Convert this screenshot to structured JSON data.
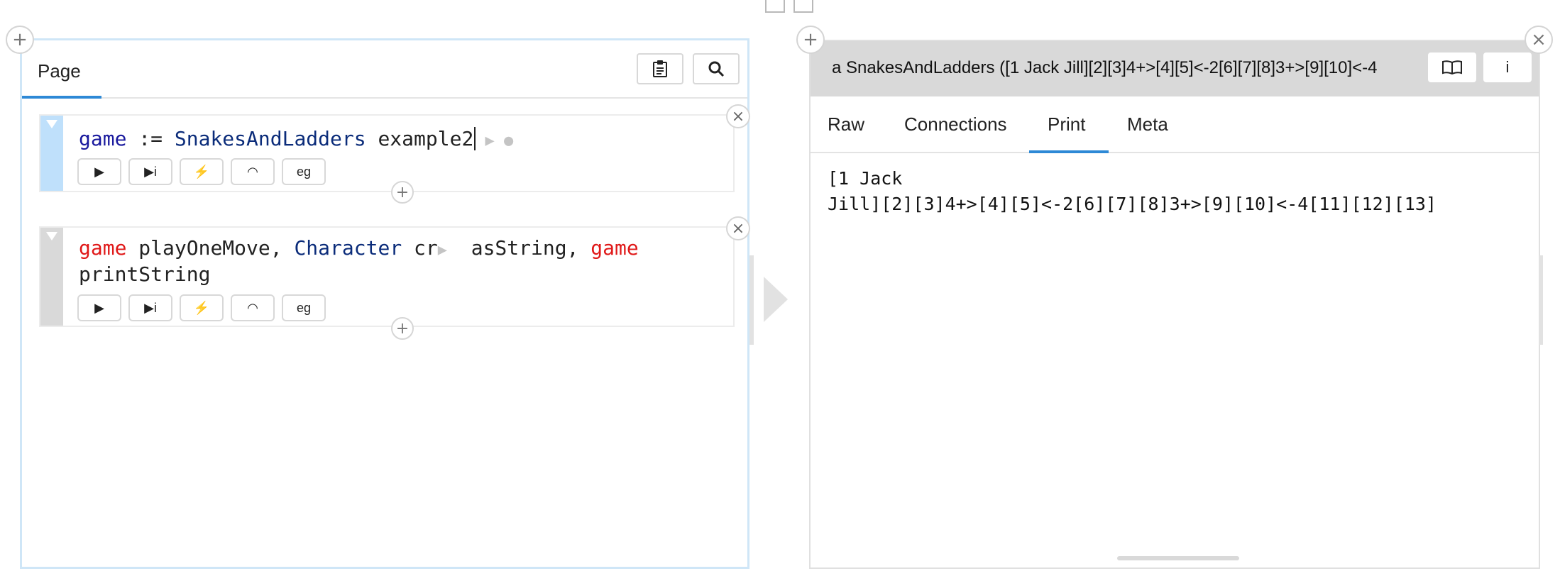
{
  "left_pane": {
    "tab_label": "Page",
    "clipboard_icon": "clipboard-icon",
    "search_icon": "search-icon",
    "snippets": [
      {
        "tokens": [
          {
            "t": "game",
            "c": "var"
          },
          {
            "t": " := ",
            "c": "plain"
          },
          {
            "t": "SnakesAndLadders",
            "c": "cls"
          },
          {
            "t": " example2",
            "c": "plain"
          }
        ],
        "buttons": [
          "play",
          "play-inspect",
          "debug",
          "profile",
          "eg"
        ],
        "eg_label": "eg"
      },
      {
        "line1": [
          {
            "t": "game",
            "c": "game"
          },
          {
            "t": " playOneMove, ",
            "c": "plain"
          },
          {
            "t": "Character",
            "c": "cls"
          },
          {
            "t": " cr",
            "c": "plain"
          },
          {
            "t": "  asString, ",
            "c": "plain"
          },
          {
            "t": "game",
            "c": "game"
          }
        ],
        "line2": "printString",
        "eg_label": "eg"
      }
    ]
  },
  "right_pane": {
    "title": "a SnakesAndLadders ([1 Jack Jill][2][3]4+>[4][5]<-2[6][7][8]3+>[9][10]<-4",
    "book_icon": "book-icon",
    "info_label": "i",
    "tabs": [
      "Raw",
      "Connections",
      "Print",
      "Meta"
    ],
    "active_tab": "Print",
    "print_lines": [
      "[1 Jack",
      "Jill][2][3]4+>[4][5]<-2[6][7][8]3+>[9][10]<-4[11][12][13]"
    ]
  },
  "colors": {
    "accent": "#2d89d6",
    "selected_bar": "#bfe0fb",
    "game_red": "#e01818"
  }
}
